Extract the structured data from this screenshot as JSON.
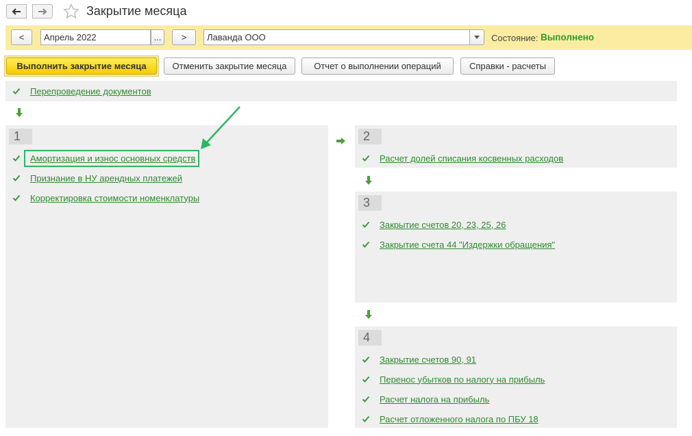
{
  "window": {
    "title": "Закрытие месяца",
    "back_icon": "arrow-left-icon",
    "forward_icon": "arrow-right-icon",
    "favorite_icon": "star-icon"
  },
  "filter": {
    "prev_label": "<",
    "period_value": "Апрель 2022",
    "period_choose_label": "...",
    "next_label": ">",
    "organization_value": "Лаванда ООО",
    "status_label": "Состояние:",
    "status_value": "Выполнено",
    "status_color": "#2e9a2e",
    "panel_color": "#faeda2"
  },
  "toolbar": {
    "execute_label": "Выполнить закрытие месяца",
    "cancel_label": "Отменить закрытие месяца",
    "report_label": "Отчет о выполнении операций",
    "references_label": "Справки - расчеты"
  },
  "operations": {
    "pre": {
      "label": "Перепроведение документов"
    },
    "stages": [
      {
        "number": "1",
        "items": [
          "Амортизация и износ основных средств",
          "Признание в НУ арендных платежей",
          "Корректировка стоимости номенклатуры"
        ]
      },
      {
        "number": "2",
        "items": [
          "Расчет долей списания косвенных расходов"
        ]
      },
      {
        "number": "3",
        "items": [
          "Закрытие счетов 20, 23, 25, 26",
          "Закрытие счета 44 \"Издержки обращения\""
        ]
      },
      {
        "number": "4",
        "items": [
          "Закрытие счетов 90, 91",
          "Перенос убытков по налогу на прибыль",
          "Расчет налога на прибыль",
          "Расчет отложенного налога по ПБУ 18"
        ]
      }
    ],
    "link_color": "#2f8a2f",
    "check_icon": "check-icon"
  },
  "annotation": {
    "highlight_color": "#2db661"
  }
}
